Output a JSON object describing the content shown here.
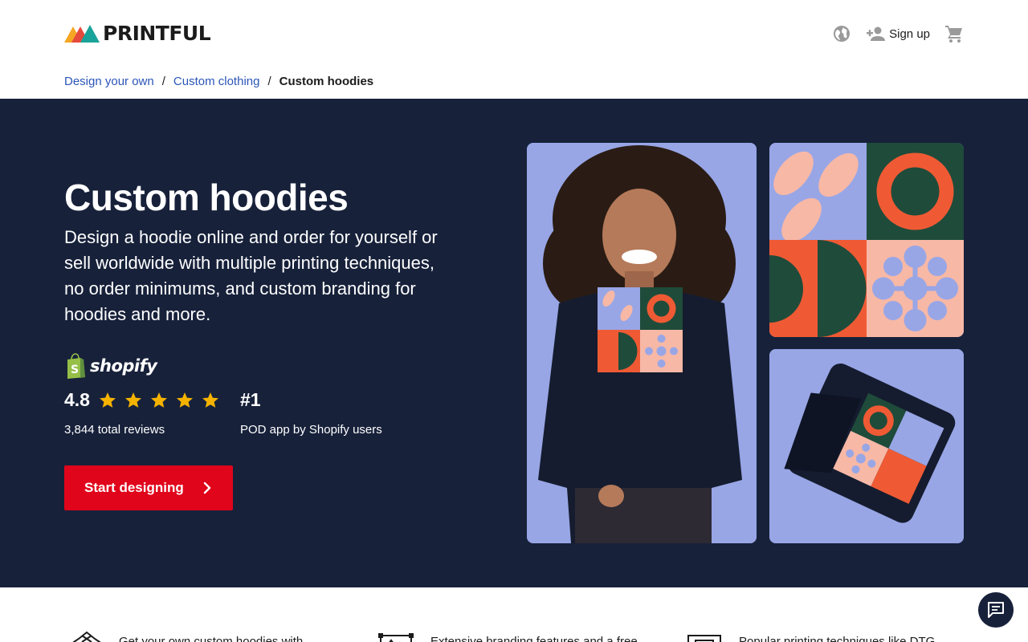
{
  "header": {
    "logo_text": "PRINTFUL",
    "signup_label": "Sign up"
  },
  "breadcrumb": {
    "items": [
      "Design your own",
      "Custom clothing"
    ],
    "separator": "/",
    "current": "Custom hoodies"
  },
  "hero": {
    "title": "Custom hoodies",
    "subtitle": "Design a hoodie online and order for yourself or sell worldwide with multiple printing techniques, no order minimums, and custom branding for hoodies and more.",
    "shopify_label": "shopify",
    "rating_value": "4.8",
    "rating_stars": 5,
    "reviews": "3,844 total reviews",
    "rank": "#1",
    "rank_label": "POD app by Shopify users",
    "cta_label": "Start designing"
  },
  "features": [
    {
      "icon": "shirt-icon",
      "text": "Get your own custom hoodies with"
    },
    {
      "icon": "branding-icon",
      "text": "Extensive branding features and a free"
    },
    {
      "icon": "printer-icon",
      "text": "Popular printing techniques like DTG"
    }
  ],
  "colors": {
    "hero_bg": "#17213a",
    "cta": "#e0051b",
    "link": "#2c56b8",
    "image_bg": "#98a6e6"
  }
}
